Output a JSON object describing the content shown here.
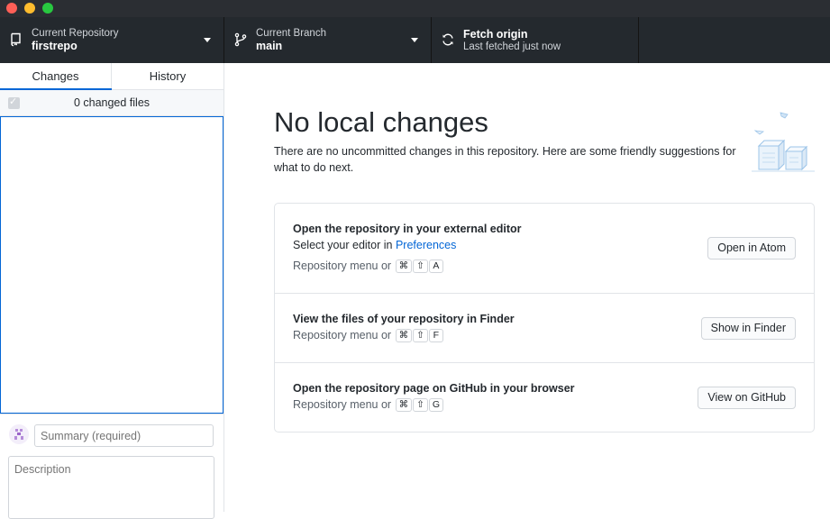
{
  "toolbar": {
    "repository": {
      "label": "Current Repository",
      "value": "firstrepo"
    },
    "branch": {
      "label": "Current Branch",
      "value": "main"
    },
    "fetch": {
      "label": "Fetch origin",
      "sub": "Last fetched just now"
    }
  },
  "sidebar": {
    "tabs": [
      "Changes",
      "History"
    ],
    "changed_files": "0 changed files",
    "summary_placeholder": "Summary (required)",
    "description_placeholder": "Description"
  },
  "main": {
    "heading": "No local changes",
    "lead": "There are no uncommitted changes in this repository. Here are some friendly suggestions for what to do next.",
    "suggestions": [
      {
        "title": "Open the repository in your external editor",
        "text": "Select your editor in ",
        "link": "Preferences",
        "meta": "Repository menu or",
        "keys": [
          "⌘",
          "⇧",
          "A"
        ],
        "button": "Open in Atom"
      },
      {
        "title": "View the files of your repository in Finder",
        "meta": "Repository menu or",
        "keys": [
          "⌘",
          "⇧",
          "F"
        ],
        "button": "Show in Finder"
      },
      {
        "title": "Open the repository page on GitHub in your browser",
        "meta": "Repository menu or",
        "keys": [
          "⌘",
          "⇧",
          "G"
        ],
        "button": "View on GitHub"
      }
    ]
  },
  "colors": {
    "toolbar": "#24292e",
    "accent": "#0366d6"
  }
}
